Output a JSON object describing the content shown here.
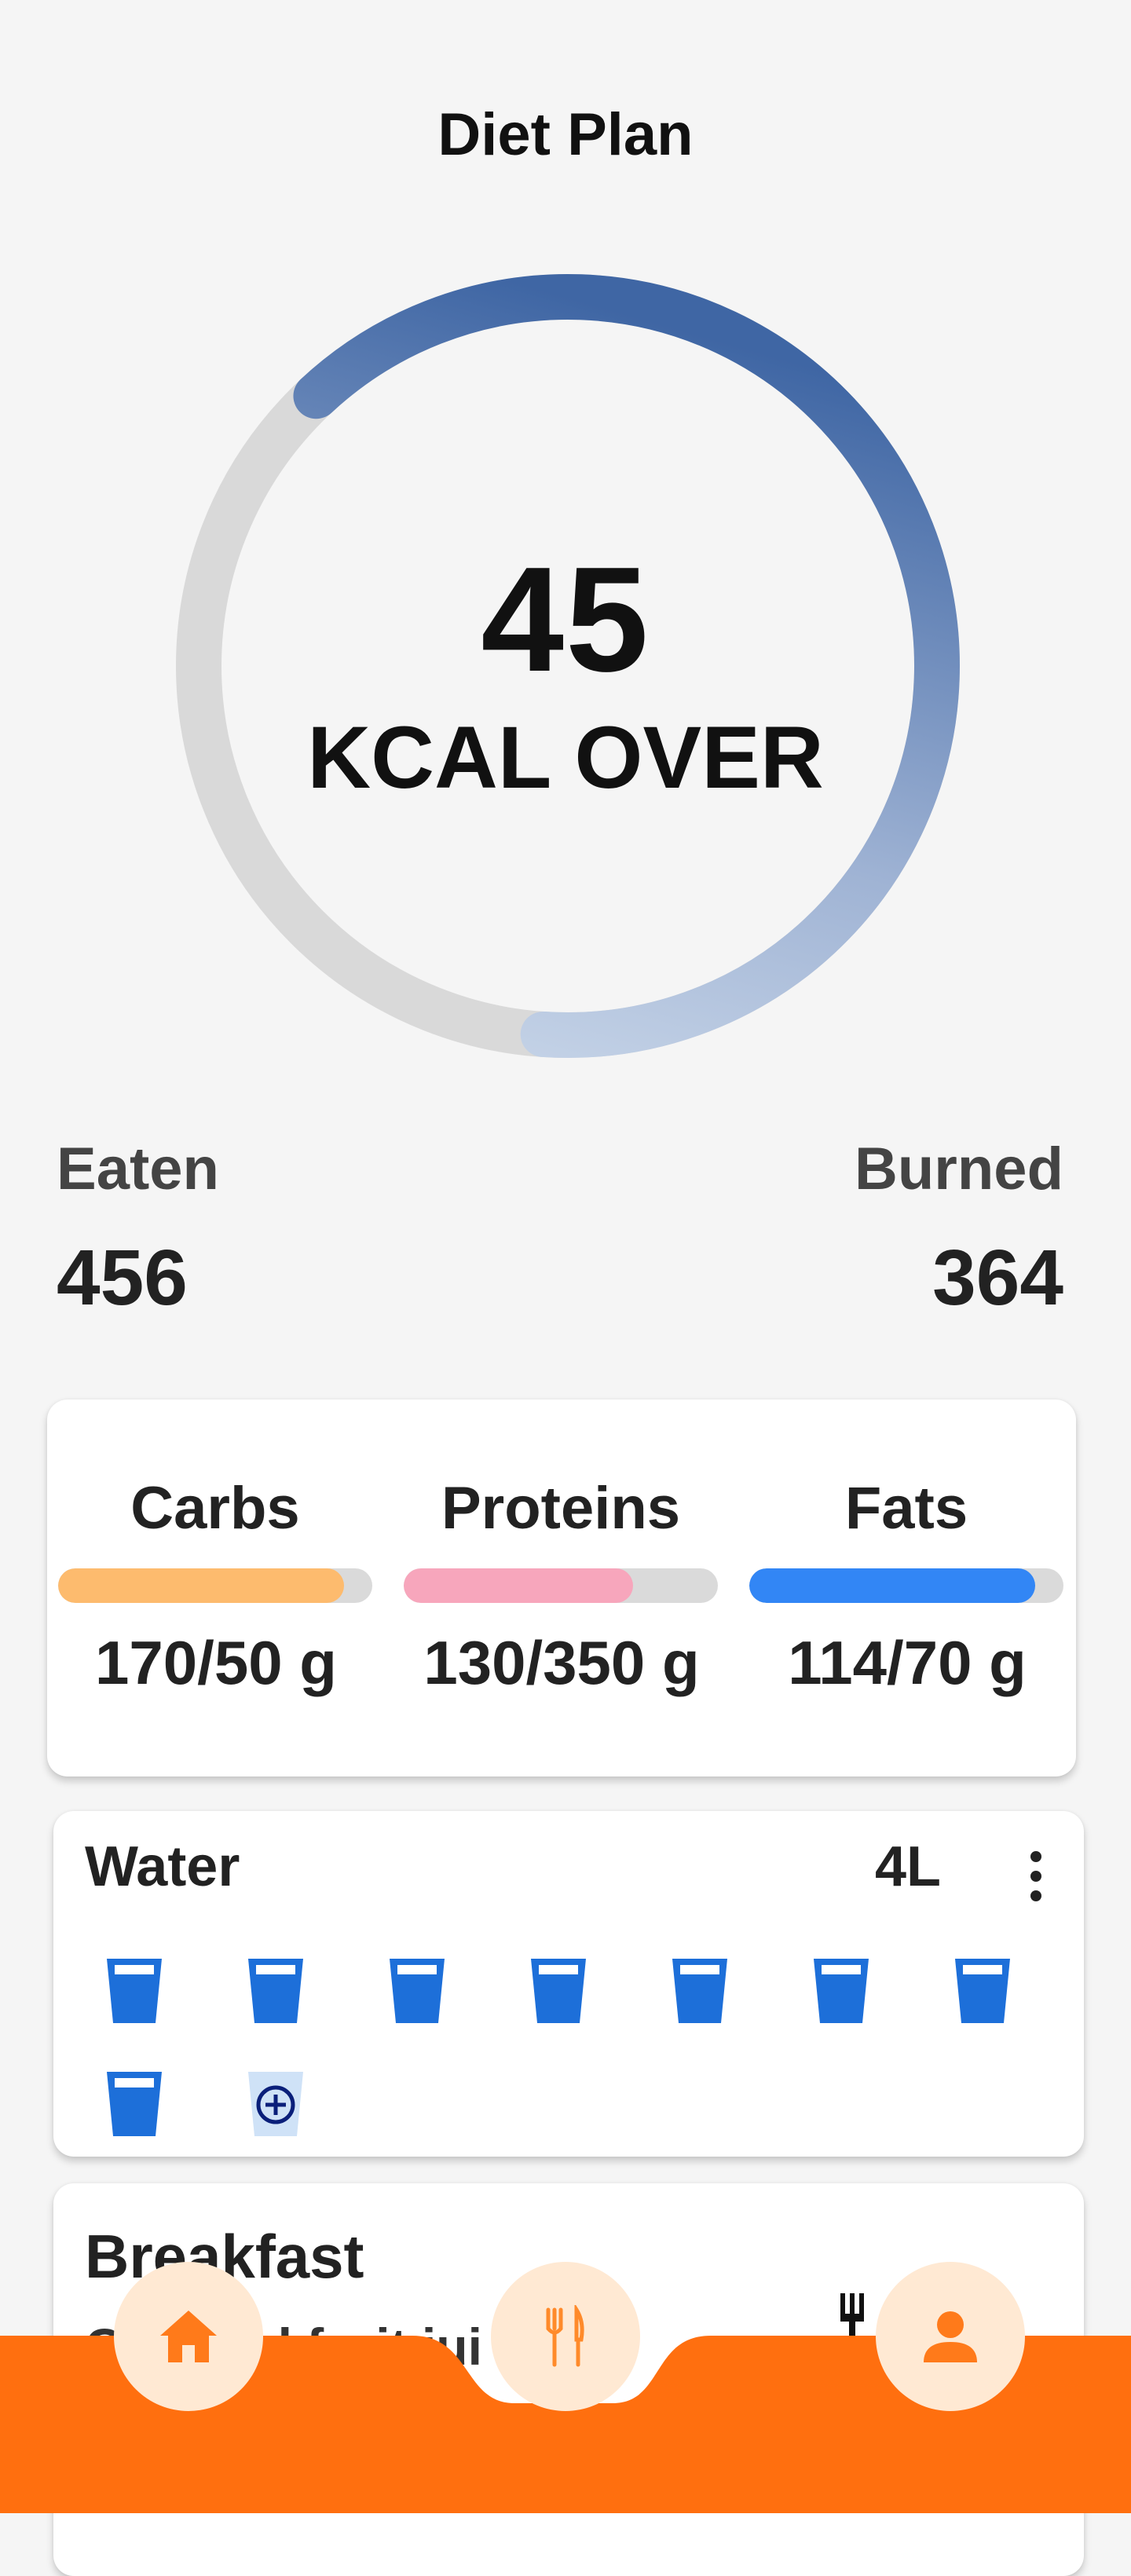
{
  "header": {
    "title": "Diet Plan"
  },
  "calorie_ring": {
    "value": "45",
    "label": "KCAL OVER",
    "progress": 0.63
  },
  "stats": {
    "eaten": {
      "label": "Eaten",
      "value": "456"
    },
    "burned": {
      "label": "Burned",
      "value": "364"
    }
  },
  "macros": [
    {
      "name": "Carbs",
      "value": "170/50 g",
      "fill": 0.91,
      "color": "#fdbb6e"
    },
    {
      "name": "Proteins",
      "value": "130/350 g",
      "fill": 0.73,
      "color": "#f7a6bc"
    },
    {
      "name": "Fats",
      "value": "114/70 g",
      "fill": 0.91,
      "color": "#3286f5"
    }
  ],
  "water": {
    "title": "Water",
    "amount": "4L",
    "glasses_filled": 8
  },
  "meals": {
    "breakfast": {
      "title": "Breakfast",
      "item": "Cup and fruit jui"
    }
  },
  "colors": {
    "accent": "#ff6f0f",
    "ring_start": "#d0dcec",
    "ring_end": "#3f67a5",
    "ring_track": "#d9d9d9",
    "water_blue": "#1d6fd9"
  },
  "icons": {
    "home": "home-icon",
    "meals": "fork-knife-icon",
    "profile": "person-icon",
    "add_glass": "plus-circle-icon",
    "menu": "more-vertical-icon"
  }
}
